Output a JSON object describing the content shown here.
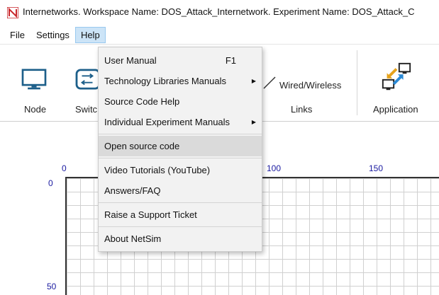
{
  "window": {
    "title": "Internetworks. Workspace Name: DOS_Attack_Internetwork. Experiment Name: DOS_Attack_C"
  },
  "menubar": {
    "items": [
      {
        "label": "File"
      },
      {
        "label": "Settings"
      },
      {
        "label": "Help"
      }
    ]
  },
  "ribbon": {
    "node_label": "Node",
    "switch_label": "Switc",
    "links_type_label": "Wired/Wireless",
    "links_label": "Links",
    "application_label": "Application"
  },
  "help_menu": {
    "items": [
      {
        "label": "User Manual",
        "shortcut": "F1"
      },
      {
        "label": "Technology Libraries Manuals"
      },
      {
        "label": "Source Code Help"
      },
      {
        "label": "Individual Experiment Manuals"
      },
      {
        "label": "Open source code"
      },
      {
        "label": "Video Tutorials (YouTube)"
      },
      {
        "label": "Answers/FAQ"
      },
      {
        "label": "Raise a Support Ticket"
      },
      {
        "label": "About NetSim"
      }
    ]
  },
  "canvas": {
    "x_ticks": [
      "0",
      "100",
      "150"
    ],
    "y_ticks": [
      "0",
      "50"
    ]
  },
  "colors": {
    "accent": "#2b8ad6",
    "menu_active": "#cce4f7",
    "tick_text": "#1a1aa0",
    "logo_red": "#c8262b"
  }
}
